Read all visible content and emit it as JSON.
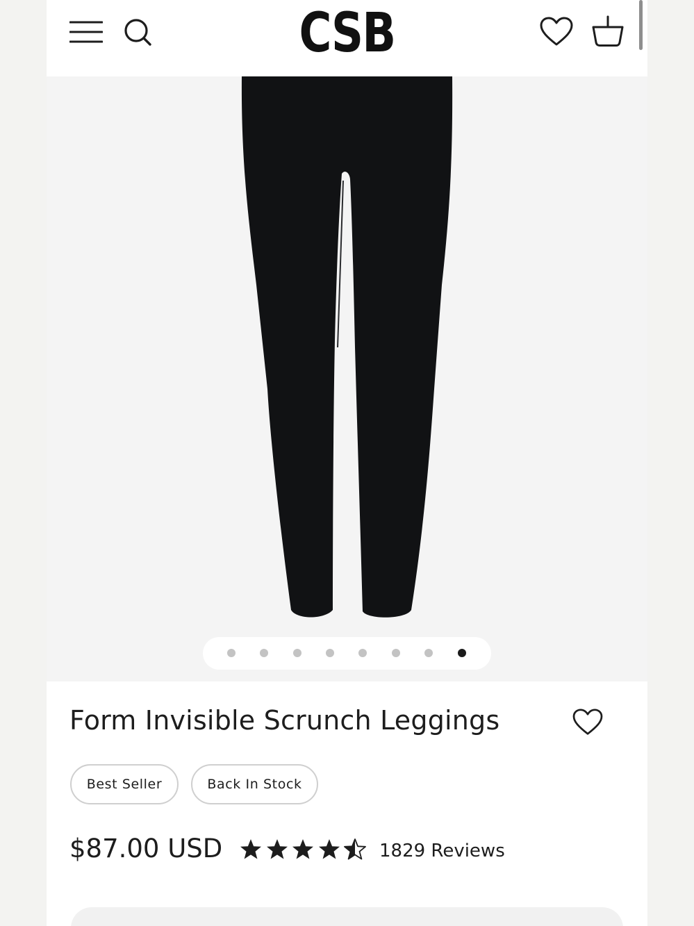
{
  "header": {
    "logo": "CSB",
    "icons": [
      "menu-icon",
      "search-icon",
      "heart-icon",
      "basket-icon"
    ]
  },
  "gallery": {
    "image": "black-leggings",
    "slide_count": 8,
    "active_slide": 8
  },
  "product": {
    "title": "Form Invisible Scrunch Leggings",
    "badges": [
      "Best Seller",
      "Back In Stock"
    ],
    "price": "$87.00 USD",
    "rating": 4.5,
    "reviews_label": "1829 Reviews"
  },
  "colors": {
    "background": "#ffffff",
    "gallery_background": "#f4f4f4",
    "text": "#1d1d1d",
    "dot_inactive": "#c3c3c3",
    "dot_active": "#1b1b1b"
  }
}
